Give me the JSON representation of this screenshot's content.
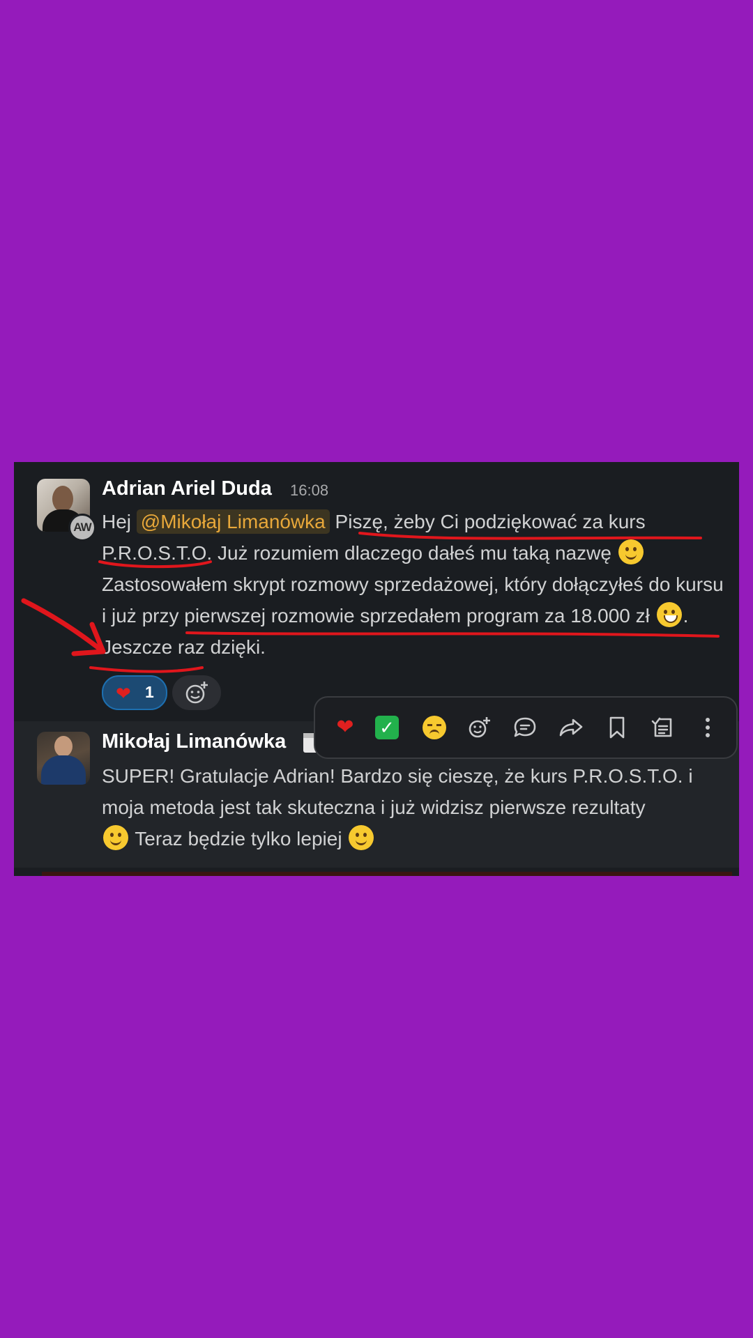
{
  "background_color": "#951bbb",
  "annotation_color": "#e0161c",
  "messages": [
    {
      "author": "Adrian Ariel Duda",
      "time": "16:08",
      "avatar_badge": "AW",
      "text": {
        "greeting": "Hej",
        "mention": "@Mikołaj Limanówka",
        "part1": "Piszę, żeby Ci podziękować za kurs P.R.O.S.T.O. Już rozumiem dlaczego dałeś mu taką nazwę",
        "part2": "Zastosowałem skrypt rozmowy sprzedażowej, który dołączyłeś do kursu i już przy pierwszej rozmowie sprzedałem program za 18.000 zł",
        "part3": ". Jeszcze raz dzięki."
      },
      "reactions": [
        {
          "icon": "heart-icon",
          "count": "1"
        }
      ]
    },
    {
      "author": "Mikołaj Limanówka",
      "text": {
        "part1": "SUPER! Gratulacje Adrian! Bardzo się cieszę, że kurs P.R.O.S.T.O. i moja metoda jest tak skuteczna i już widzisz pierwsze rezultaty",
        "part2": "Teraz będzie tylko lepiej"
      }
    }
  ],
  "toolbar": {
    "icons": [
      "heart-icon",
      "check-mark-icon",
      "disappointed-face-icon",
      "add-reaction-icon",
      "reply-in-thread-icon",
      "forward-icon",
      "bookmark-icon",
      "mark-unread-icon",
      "more-vertical-icon"
    ]
  }
}
